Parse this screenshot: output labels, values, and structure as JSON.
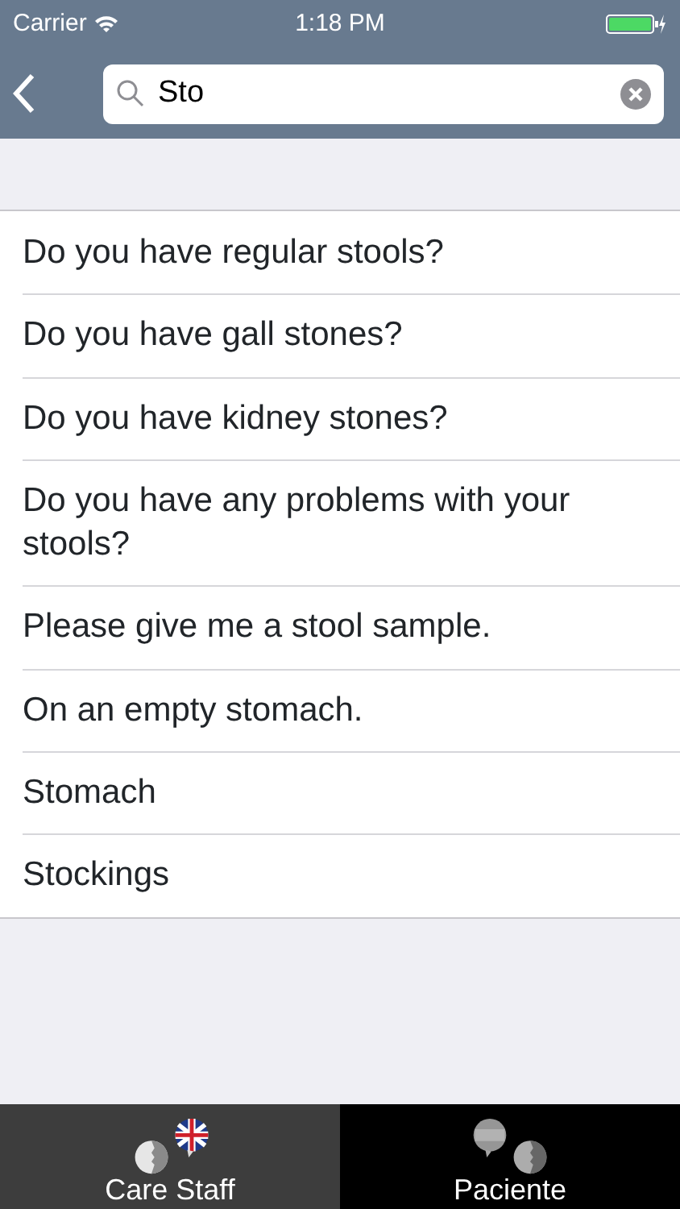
{
  "status_bar": {
    "carrier": "Carrier",
    "time": "1:18 PM"
  },
  "search": {
    "value": "Sto"
  },
  "results": [
    {
      "text": "Do you have regular stools?"
    },
    {
      "text": "Do you have gall stones?"
    },
    {
      "text": "Do you have kidney stones?"
    },
    {
      "text": "Do you have any problems with your stools?"
    },
    {
      "text": "Please give me a stool sample."
    },
    {
      "text": "On an empty stomach."
    },
    {
      "text": "Stomach"
    },
    {
      "text": "Stockings"
    }
  ],
  "tabs": [
    {
      "label": "Care Staff",
      "selected": true,
      "kind": "uk"
    },
    {
      "label": "Paciente",
      "selected": false,
      "kind": "es"
    }
  ]
}
